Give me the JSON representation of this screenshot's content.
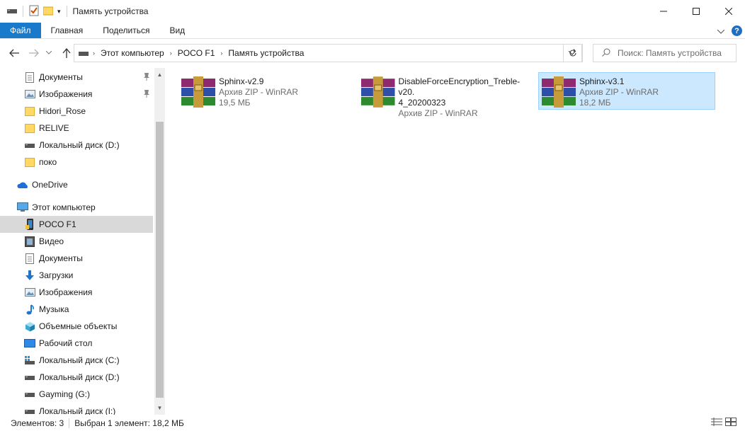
{
  "window": {
    "title": "Память устройства"
  },
  "ribbon": {
    "tabs": [
      "Файл",
      "Главная",
      "Поделиться",
      "Вид"
    ]
  },
  "address": {
    "crumbs": [
      "Этот компьютер",
      "POCO F1",
      "Память устройства"
    ],
    "search_placeholder": "Поиск: Память устройства"
  },
  "nav": {
    "items": [
      {
        "label": "Документы",
        "icon": "documents-icon",
        "pinned": true
      },
      {
        "label": "Изображения",
        "icon": "pictures-icon",
        "pinned": true
      },
      {
        "label": "Hidori_Rose",
        "icon": "folder-icon"
      },
      {
        "label": "RELIVE",
        "icon": "folder-icon"
      },
      {
        "label": "Локальный диск (D:)",
        "icon": "drive-icon"
      },
      {
        "label": "поко",
        "icon": "folder-icon"
      },
      {
        "label": "OneDrive",
        "icon": "onedrive-icon"
      },
      {
        "label": "Этот компьютер",
        "icon": "computer-icon"
      },
      {
        "label": "POCO F1",
        "icon": "phone-icon",
        "selected": true
      },
      {
        "label": "Видео",
        "icon": "video-icon"
      },
      {
        "label": "Документы",
        "icon": "documents-icon"
      },
      {
        "label": "Загрузки",
        "icon": "downloads-icon"
      },
      {
        "label": "Изображения",
        "icon": "pictures-icon"
      },
      {
        "label": "Музыка",
        "icon": "music-icon"
      },
      {
        "label": "Объемные объекты",
        "icon": "3d-objects-icon"
      },
      {
        "label": "Рабочий стол",
        "icon": "desktop-icon"
      },
      {
        "label": "Локальный диск (C:)",
        "icon": "windows-drive-icon"
      },
      {
        "label": "Локальный диск (D:)",
        "icon": "drive-icon"
      },
      {
        "label": "Gayming (G:)",
        "icon": "drive-icon"
      },
      {
        "label": "Локальный диск (I:)",
        "icon": "drive-icon"
      }
    ]
  },
  "files": [
    {
      "name": "Sphinx-v2.9",
      "type": "Архив ZIP - WinRAR",
      "size": "19,5 МБ"
    },
    {
      "name_line1": "DisableForceEncryption_Treble-v20.",
      "name_line2": "4_20200323",
      "type": "Архив ZIP - WinRAR"
    },
    {
      "name": "Sphinx-v3.1",
      "type": "Архив ZIP - WinRAR",
      "size": "18,2 МБ",
      "selected": true
    }
  ],
  "status": {
    "count": "Элементов: 3",
    "selection": "Выбран 1 элемент: 18,2 МБ"
  },
  "colors": {
    "file_tab": "#1979ca",
    "selection_bg": "#cce8ff",
    "selection_border": "#99d1ff"
  }
}
